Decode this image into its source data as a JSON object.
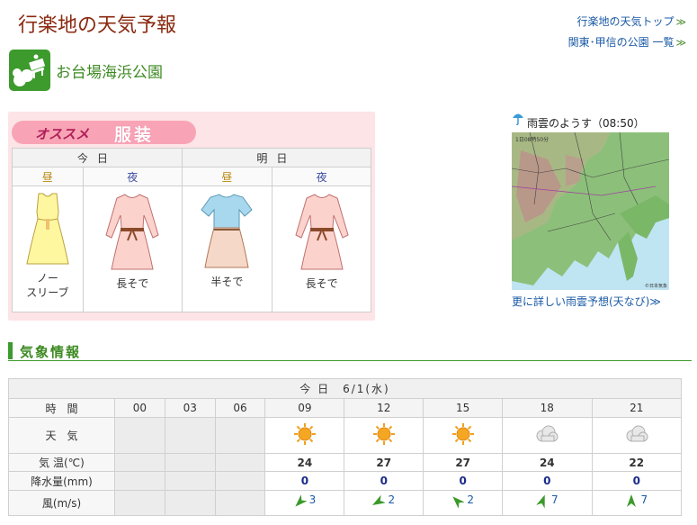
{
  "header": {
    "title": "行楽地の天気予報",
    "links": [
      {
        "label": "行楽地の天気トップ",
        "arrow": "≫"
      },
      {
        "label": "関東･甲信の公園 一覧",
        "arrow": "≫"
      }
    ]
  },
  "park": {
    "name": "お台場海浜公園",
    "icon": "park-bench-icon"
  },
  "clothing": {
    "banner_prefix": "オススメ",
    "banner_main": "服装",
    "days": [
      "今日",
      "明日"
    ],
    "times": [
      "昼",
      "夜",
      "昼",
      "夜"
    ],
    "items": [
      {
        "label_line1": "ノー",
        "label_line2": "スリーブ",
        "icon": "sleeveless-dress-icon",
        "color": "#fff8a8"
      },
      {
        "label_line1": "長そで",
        "label_line2": "",
        "icon": "long-sleeve-dress-icon",
        "color": "#fcd2cc"
      },
      {
        "label_line1": "半そで",
        "label_line2": "",
        "icon": "short-sleeve-dress-icon",
        "color": "#a8d8ee"
      },
      {
        "label_line1": "長そで",
        "label_line2": "",
        "icon": "long-sleeve-dress-icon",
        "color": "#fcd2cc"
      }
    ]
  },
  "radar": {
    "title": "雨雲のようす（08:50）",
    "map_caption": "1日08時50分",
    "map_credit": "©日本気象",
    "link": "更に詳しい雨雲予想(天なび)",
    "link_arrow": "≫"
  },
  "section": {
    "title": "気象情報"
  },
  "weather": {
    "date_label": "今 日　6/1(水)",
    "row_labels": {
      "time": "時　間",
      "weather": "天　気",
      "temp": "気 温(℃)",
      "rain": "降水量(mm)",
      "wind": "風(m/s)"
    },
    "hours": [
      "00",
      "03",
      "06",
      "09",
      "12",
      "15",
      "18",
      "21"
    ],
    "conditions": [
      "",
      "",
      "",
      "sunny",
      "sunny",
      "sunny",
      "cloudy",
      "cloudy"
    ],
    "temps": [
      "",
      "",
      "",
      "24",
      "27",
      "27",
      "24",
      "22"
    ],
    "rain": [
      "",
      "",
      "",
      "0",
      "0",
      "0",
      "0",
      "0"
    ],
    "wind_speed": [
      "",
      "",
      "",
      "3",
      "2",
      "2",
      "7",
      "7"
    ],
    "wind_dir_deg": [
      null,
      null,
      null,
      225,
      240,
      315,
      20,
      0
    ]
  }
}
